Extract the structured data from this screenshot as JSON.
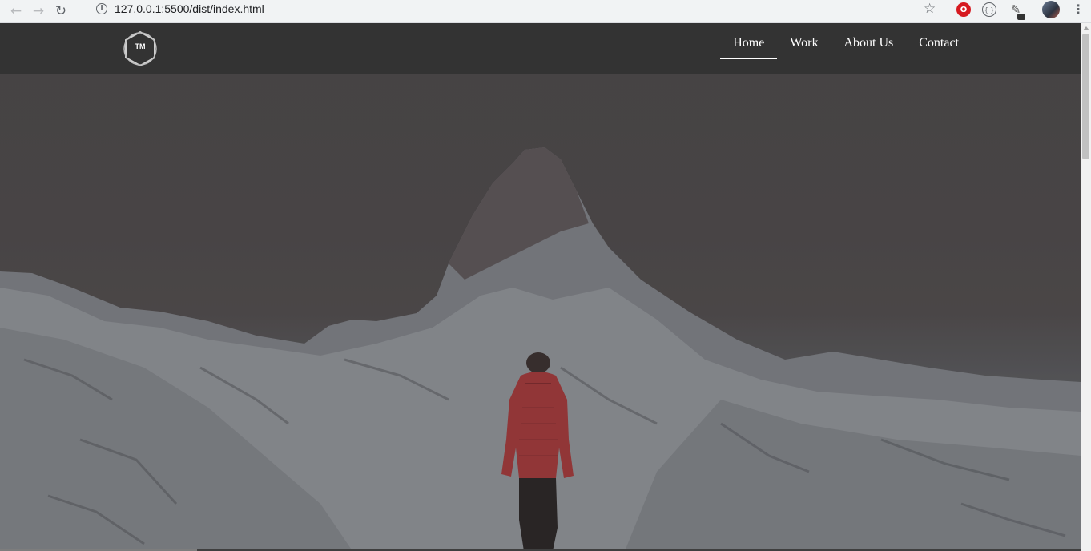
{
  "browser": {
    "url": "127.0.0.1:5500/dist/index.html",
    "back_icon": "←",
    "forward_icon": "→",
    "reload_icon": "↻",
    "info_icon": "i",
    "star_icon": "☆",
    "ext_red_label": "O",
    "ext_json_label": "{ }",
    "ext_pen_icon": "✎",
    "menu_icon": "⋮"
  },
  "site": {
    "logo_text": "TM",
    "nav": [
      {
        "label": "Home",
        "active": true
      },
      {
        "label": "Work",
        "active": false
      },
      {
        "label": "About Us",
        "active": false
      },
      {
        "label": "Contact",
        "active": false
      }
    ]
  },
  "colors": {
    "header_bg": "#333333",
    "nav_text": "#ffffff",
    "jacket": "#a0383a"
  }
}
